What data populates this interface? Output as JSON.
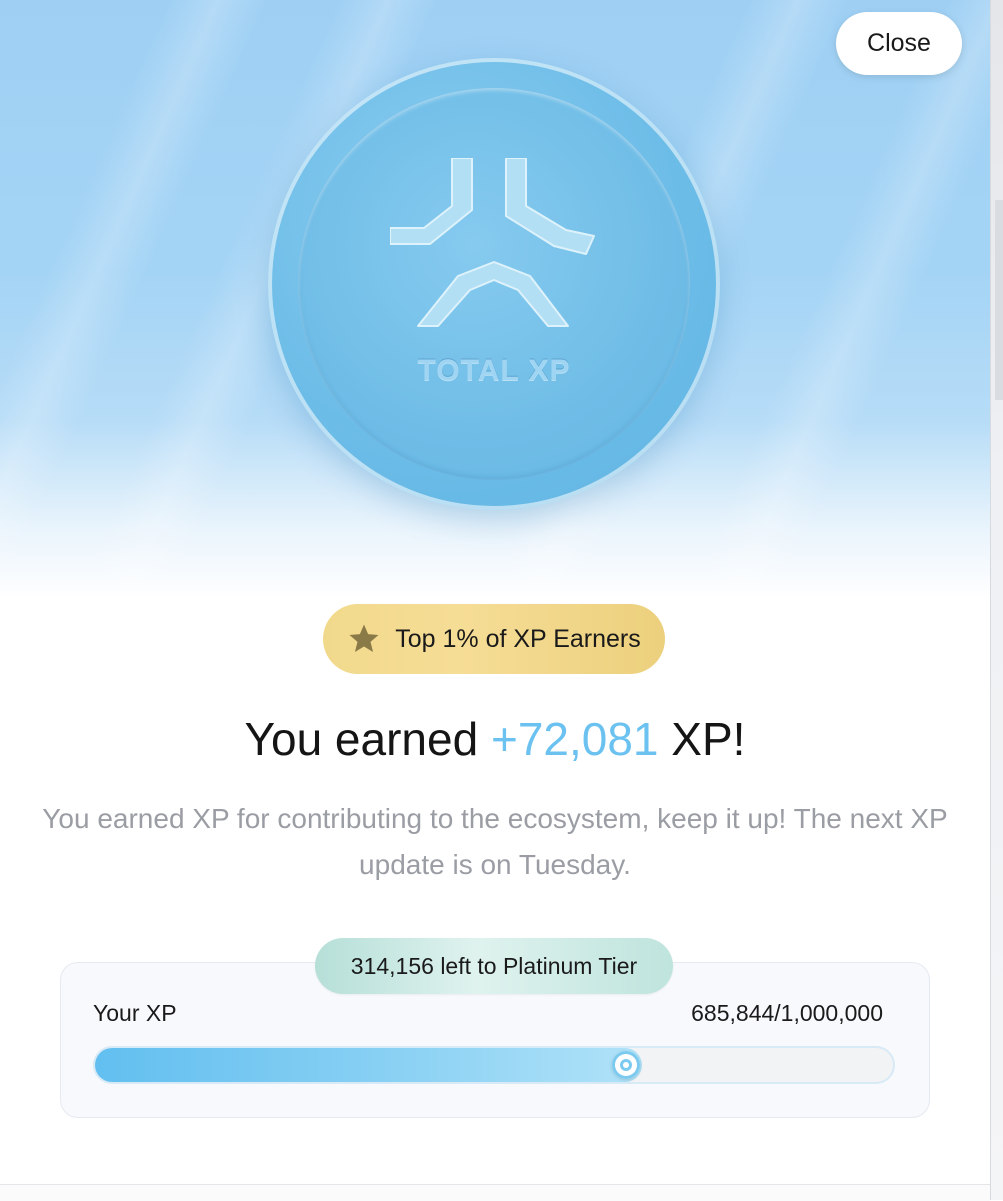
{
  "close_button": {
    "label": "Close"
  },
  "coin": {
    "label": "TOTAL XP",
    "logo_icon": "xp-logo-icon"
  },
  "badge": {
    "icon": "star-icon",
    "text": "Top 1% of XP Earners"
  },
  "headline": {
    "prefix": "You earned ",
    "amount": "+72,081",
    "suffix": " XP!"
  },
  "description": "You earned XP for contributing to the ecosystem, keep it up! The next XP update is on Tuesday.",
  "progress": {
    "tier_text": "314,156 left to Platinum Tier",
    "label": "Your XP",
    "value_text": "685,844/1,000,000",
    "current": 685844,
    "max": 1000000
  },
  "colors": {
    "accent": "#6bc2f0",
    "badge_gold": "#f1d98c",
    "tier_pill": "#bfe4dd"
  }
}
